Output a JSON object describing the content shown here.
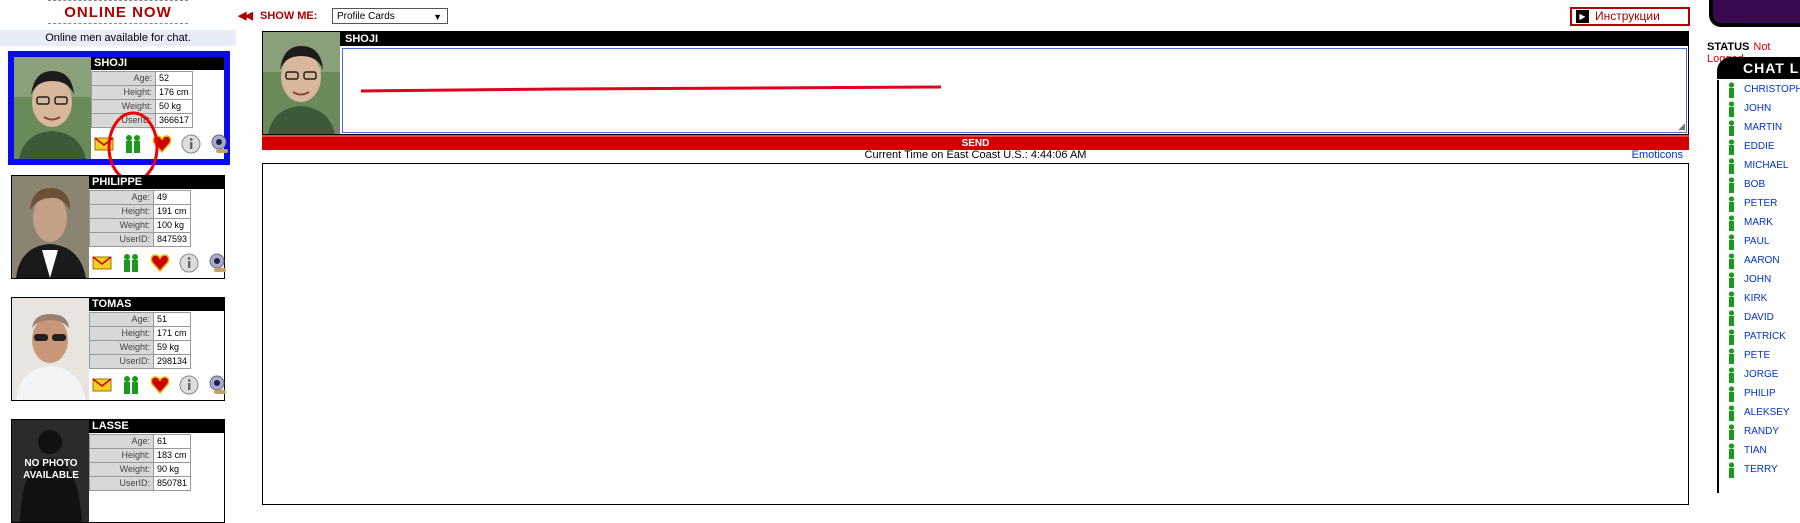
{
  "left_panel": {
    "title": "ONLINE NOW",
    "subtitle": "Online men available for chat.",
    "profiles": [
      {
        "name": "SHOJI",
        "age_label": "Age:",
        "age": "52",
        "height_label": "Height:",
        "height": "176 cm",
        "weight_label": "Weight:",
        "weight": "50 kg",
        "userid_label": "UserID:",
        "userid": "366617"
      },
      {
        "name": "PHILIPPE",
        "age_label": "Age:",
        "age": "49",
        "height_label": "Height:",
        "height": "191 cm",
        "weight_label": "Weight:",
        "weight": "100 kg",
        "userid_label": "UserID:",
        "userid": "847593"
      },
      {
        "name": "TOMAS",
        "age_label": "Age:",
        "age": "51",
        "height_label": "Height:",
        "height": "171 cm",
        "weight_label": "Weight:",
        "weight": "59 kg",
        "userid_label": "UserID:",
        "userid": "298134"
      },
      {
        "name": "LASSE",
        "age_label": "Age:",
        "age": "61",
        "height_label": "Height:",
        "height": "183 cm",
        "weight_label": "Weight:",
        "weight": "90 kg",
        "userid_label": "UserID:",
        "userid": "850781",
        "no_photo_text": "NO PHOTO AVAILABLE"
      }
    ]
  },
  "header": {
    "show_me_arrows": "◀◀",
    "show_me_label": "SHOW ME:",
    "show_me_selected": "Profile Cards",
    "instructions_label": "Инструкции"
  },
  "chat": {
    "partner_name": "SHOJI",
    "send_label": "SEND",
    "time_text": "Current Time on East Coast U.S.: 4:44:06 AM",
    "emoticons_label": "Emoticons"
  },
  "right_panel": {
    "status_label": "STATUS",
    "status_value": "Not Logged",
    "chat_list_title": "CHAT LIST",
    "members": [
      "CHRISTOPHER",
      "JOHN",
      "MARTIN",
      "EDDIE",
      "MICHAEL",
      "BOB",
      "PETER",
      "MARK",
      "PAUL",
      "AARON",
      "JOHN",
      "KIRK",
      "DAVID",
      "PATRICK",
      "PETE",
      "JORGE",
      "PHILIP",
      "ALEKSEY",
      "RANDY",
      "TIAN",
      "TERRY"
    ]
  },
  "colors": {
    "brand_red": "#b00000",
    "send_red": "#d00000",
    "selected_border": "#0a0aee",
    "link_blue": "#0033cc",
    "online_green": "#1a9a1a"
  }
}
